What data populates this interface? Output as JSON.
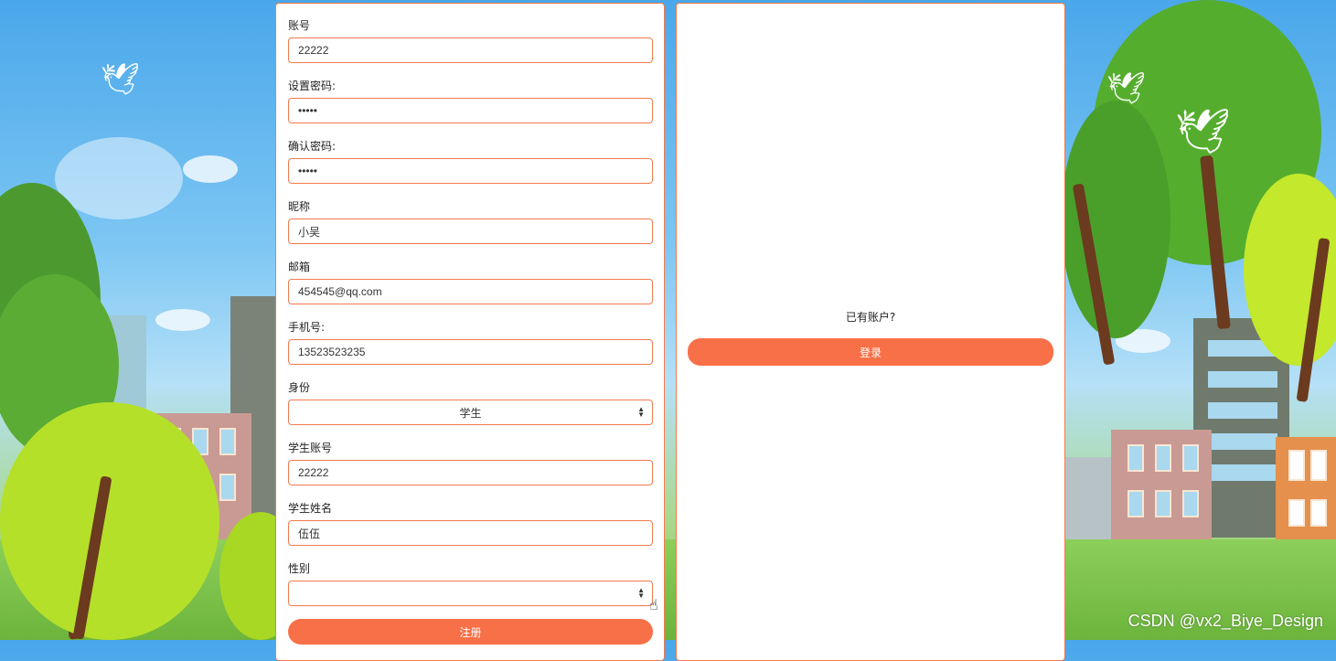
{
  "register_form": {
    "fields": [
      {
        "label": "账号",
        "value": "22222"
      },
      {
        "label": "设置密码:",
        "value": "•••••"
      },
      {
        "label": "确认密码:",
        "value": "•••••"
      },
      {
        "label": "昵称",
        "value": "小吴"
      },
      {
        "label": "邮箱",
        "value": "454545@qq.com"
      },
      {
        "label": "手机号:",
        "value": "13523523235"
      },
      {
        "label": "身份",
        "value": "学生"
      },
      {
        "label": "学生账号",
        "value": "22222"
      },
      {
        "label": "学生姓名",
        "value": "伍伍"
      },
      {
        "label": "性别",
        "value": ""
      }
    ],
    "submit_label": "注册"
  },
  "login_panel": {
    "prompt": "已有账户?",
    "button_label": "登录"
  },
  "watermark": "CSDN @vx2_Biye_Design",
  "colors": {
    "accent": "#f87047",
    "border": "#f27a4d"
  }
}
